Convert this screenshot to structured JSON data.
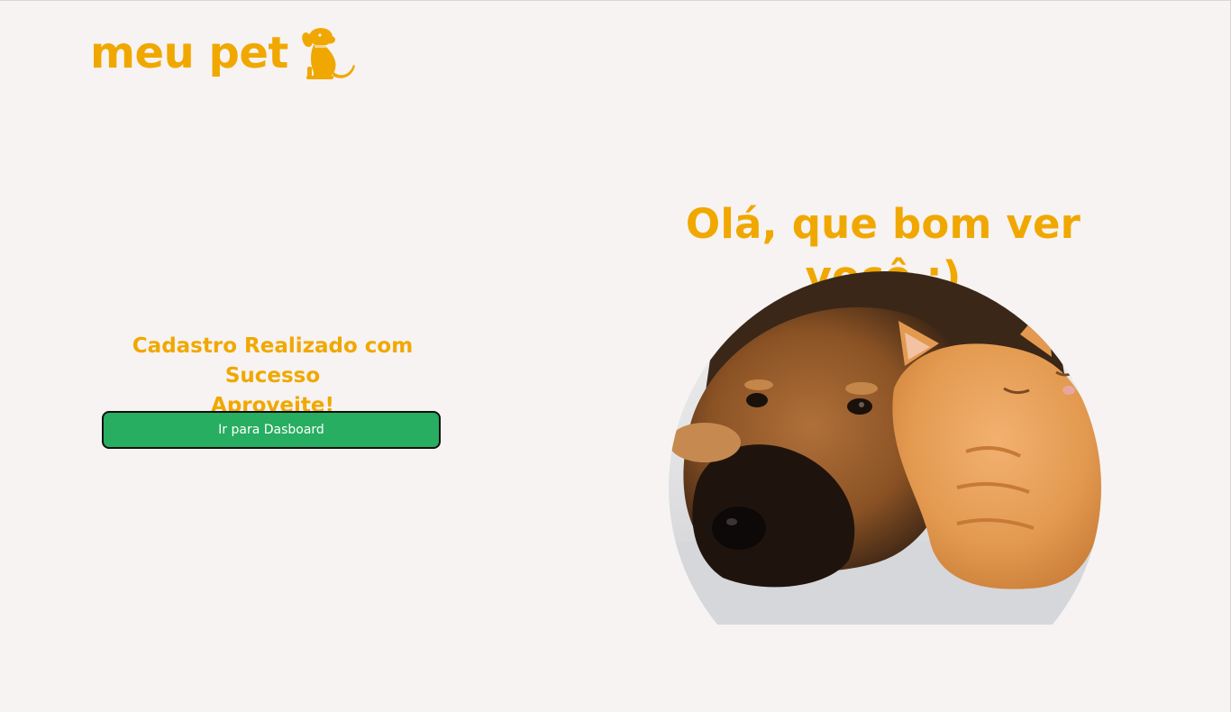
{
  "brand": {
    "name": "meu pet",
    "logo_icon": "dog-icon",
    "accent_color": "#f0a800"
  },
  "success": {
    "line1": "Cadastro Realizado com Sucesso",
    "line2": "Aproveite!"
  },
  "dashboard_button": {
    "label": "Ir para Dasboard",
    "color": "#27ae60"
  },
  "hero": {
    "greeting": "Olá, que bom ver você :)",
    "image_subject": "dog-and-cat-photo"
  }
}
